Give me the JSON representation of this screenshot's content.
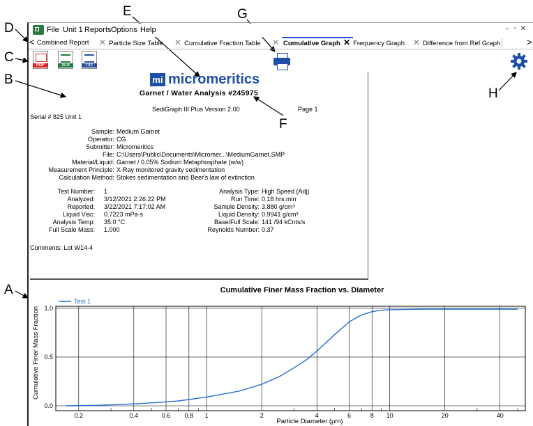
{
  "callouts": [
    "A",
    "B",
    "C",
    "D",
    "E",
    "F",
    "G",
    "H"
  ],
  "menu": {
    "items": [
      "File",
      "Unit 1",
      "Reports",
      "Options",
      "Help"
    ]
  },
  "tabs": [
    "Combined Report",
    "Particle Size Table",
    "Cumulative Fraction Table",
    "Cumulative Graph",
    "Frequency Graph",
    "Difference from Ref Graph"
  ],
  "toolbar": {
    "pdf": "PDF",
    "xls": "XLS",
    "txt": "TXT"
  },
  "report": {
    "logo_text": "micromeritics",
    "logo_mark": "mi",
    "title": "Garnet / Water Analysis #245975",
    "version": "SediGraph III Plus Version 2.00",
    "page": "Page 1",
    "serial": "Serial # 825  Unit 1",
    "info_labels": [
      "Sample:",
      "Operator:",
      "Submitter:",
      "File:",
      "Material/Liquid:",
      "Measurement Principle:",
      "Calculation Method:"
    ],
    "info_values": [
      "Medium Garnet",
      "CG",
      "Micromeritics",
      "C:\\Users\\Public\\Documents\\Micromer...\\MediumGarnet.SMP",
      "Garnet / 0.05% Sodium Metaphosphate (w/w)",
      "X-Ray monitored gravity sedimentation",
      "Stokes sedimentation and Beer's law of extinction"
    ],
    "left_labels": [
      "Test Number:",
      "Analyzed:",
      "Reported:",
      "Liquid Visc:",
      "Analysis Temp:",
      "Full Scale Mass:"
    ],
    "left_values": [
      "1",
      "3/12/2021 2:26:22 PM",
      "3/22/2021 7:17:02 AM",
      "0.7223 mPa·s",
      "35.0 °C",
      "1.000"
    ],
    "right_labels": [
      "Analysis Type:",
      "Run Time:",
      "Sample Density:",
      "Liquid Density:",
      "Base/Full Scale:",
      "Reynolds Number:"
    ],
    "right_values": [
      "High Speed (Adj)",
      "0.18 hrs:min",
      "3.880 g/cm³",
      "0.9941 g/cm³",
      "141 /94 kCnts/s",
      "0.37"
    ],
    "comments": "Comments: Lot W14-4"
  },
  "chart_data": {
    "type": "line",
    "title": "Cumulative Finer Mass Fraction vs. Diameter",
    "xlabel": "Particle Diameter (µm)",
    "ylabel": "Cumulative Finer Mass Fraction",
    "xscale": "log",
    "xlim": [
      0.15,
      55
    ],
    "ylim": [
      -0.05,
      1.02
    ],
    "x_ticks": [
      "0.2",
      "0.4",
      "0.6",
      "0.8",
      "1",
      "2",
      "4",
      "6",
      "8",
      "10",
      "20",
      "40"
    ],
    "y_ticks": [
      "0.0",
      "0.5",
      "1.0"
    ],
    "series": [
      {
        "name": "Test 1",
        "color": "#1f6fd1",
        "x": [
          0.17,
          0.25,
          0.35,
          0.5,
          0.7,
          1.0,
          1.5,
          2.0,
          2.5,
          3.0,
          3.5,
          4.0,
          4.5,
          5.0,
          6.0,
          7.0,
          8.0,
          9.0,
          10.0,
          15.0,
          20.0,
          30.0,
          40.0,
          50.0
        ],
        "y": [
          0.0,
          0.005,
          0.015,
          0.03,
          0.05,
          0.09,
          0.15,
          0.22,
          0.3,
          0.39,
          0.47,
          0.56,
          0.65,
          0.73,
          0.86,
          0.93,
          0.965,
          0.98,
          0.985,
          0.99,
          0.99,
          0.99,
          0.99,
          0.99
        ]
      }
    ]
  }
}
